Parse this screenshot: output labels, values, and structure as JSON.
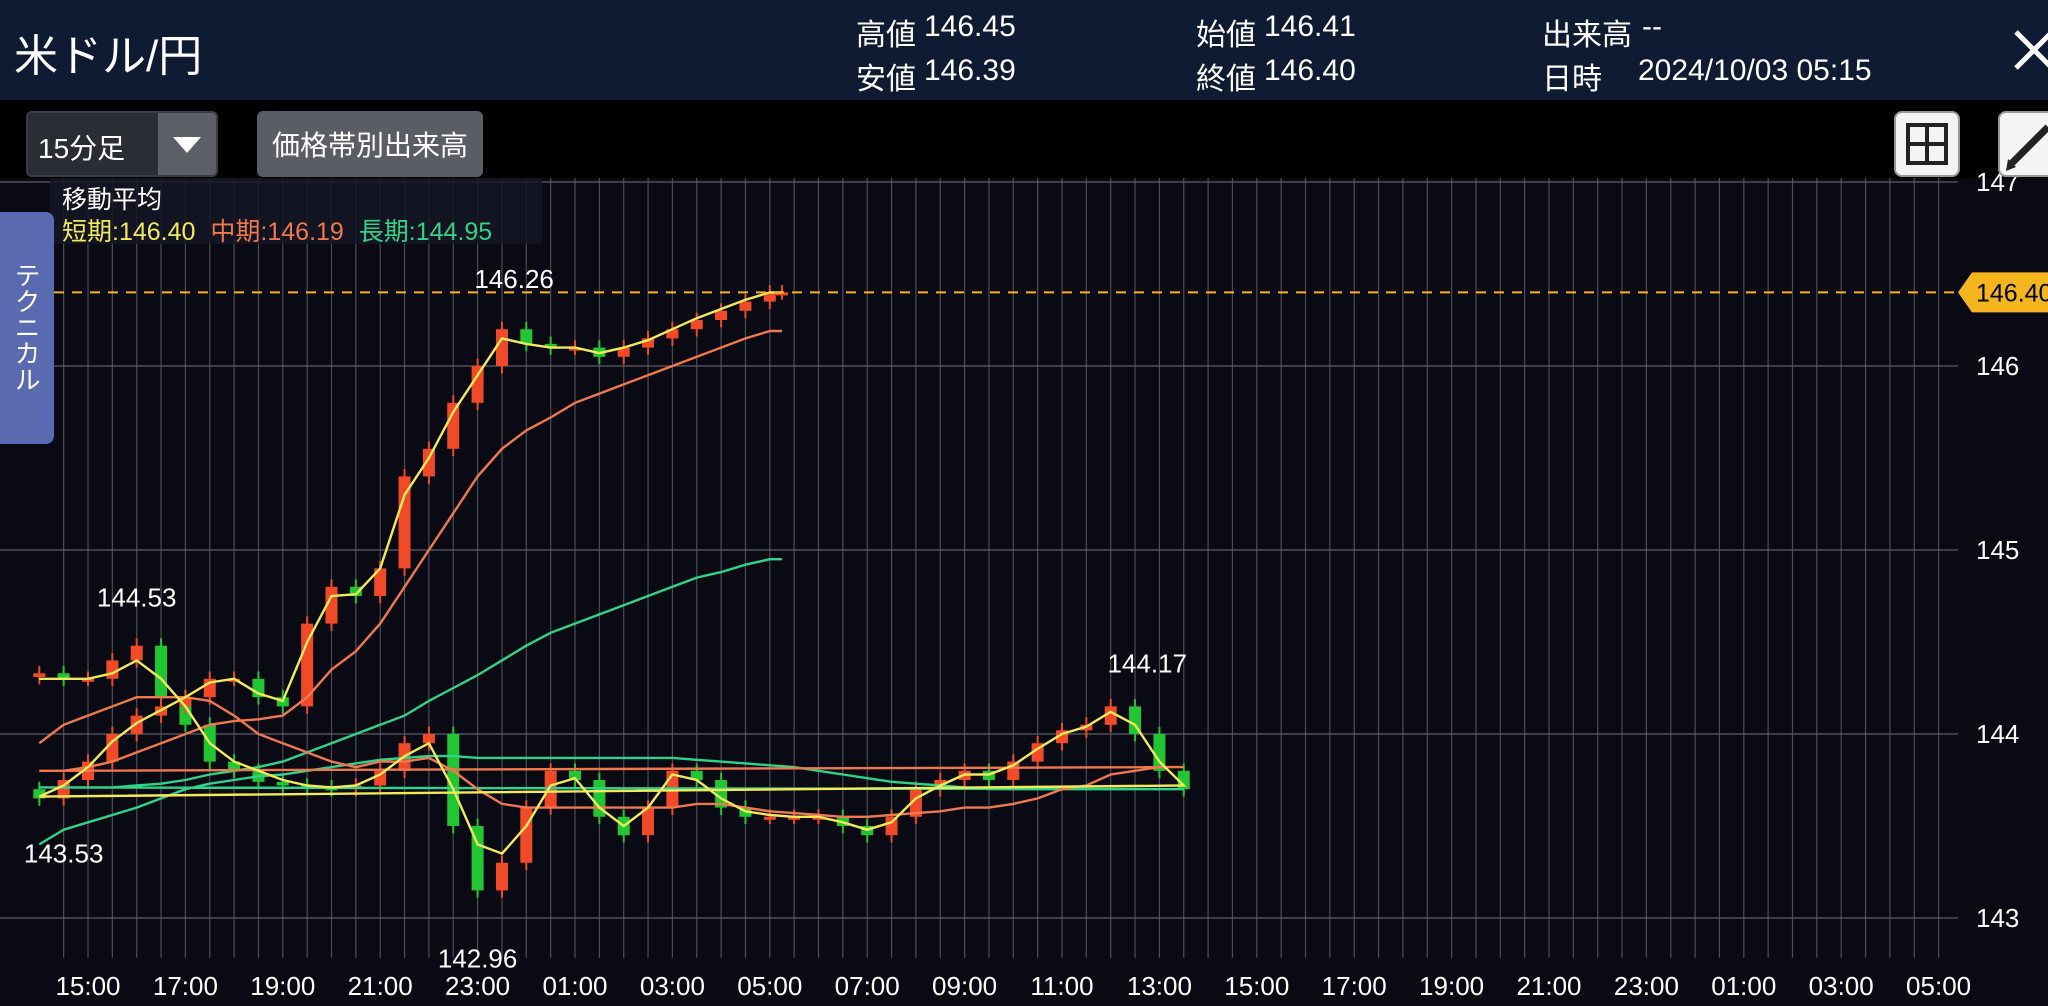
{
  "header": {
    "title": "米ドル/円",
    "stats": [
      {
        "label": "高値",
        "value": "146.45"
      },
      {
        "label": "安値",
        "value": "146.39"
      },
      {
        "label": "始値",
        "value": "146.41"
      },
      {
        "label": "終値",
        "value": "146.40"
      },
      {
        "label": "出来高",
        "value": "--"
      },
      {
        "label": "日時",
        "value": "2024/10/03 05:15"
      }
    ],
    "close_icon": "close-icon"
  },
  "toolbar": {
    "timeframe": "15分足",
    "volume_profile_label": "価格帯別出来高",
    "layout_icon": "grid-layout-icon",
    "draw_icon": "pencil-icon"
  },
  "side_tab": {
    "label": "テクニカル"
  },
  "ma_legend": {
    "title": "移動平均",
    "items": [
      {
        "label": "短期",
        "value": "146.40",
        "color": "#f2ea5a"
      },
      {
        "label": "中期",
        "value": "146.19",
        "color": "#f0784e"
      },
      {
        "label": "長期",
        "value": "144.95",
        "color": "#2fd48a"
      }
    ]
  },
  "chart_data": {
    "type": "candlestick",
    "title": "米ドル/円",
    "timeframe": "15分足",
    "x_ticks": [
      "15:00",
      "17:00",
      "19:00",
      "21:00",
      "23:00",
      "01:00",
      "03:00",
      "05:00",
      "07:00",
      "09:00",
      "11:00",
      "13:00",
      "15:00",
      "17:00",
      "19:00",
      "21:00",
      "23:00",
      "01:00",
      "03:00",
      "05:00"
    ],
    "y_ticks": [
      "143",
      "144",
      "145",
      "146",
      "147"
    ],
    "ylim": [
      142.8,
      147.0
    ],
    "current_price": "146.40",
    "annotations": [
      {
        "label": "144.53",
        "x": "16:00",
        "value": 144.53,
        "type": "high"
      },
      {
        "label": "142.96",
        "x": "23:00",
        "value": 142.96,
        "type": "low"
      },
      {
        "label": "144.17",
        "x": "12:45",
        "value": 144.17,
        "type": "high"
      },
      {
        "label": "143.53",
        "x": "14:30",
        "value": 143.53,
        "type": "low"
      },
      {
        "label": "146.26",
        "x": "23:45",
        "value": 146.26,
        "type": "high"
      }
    ],
    "up_color": "#f04a28",
    "down_color": "#22c532",
    "series_time": [
      "14:00",
      "14:30",
      "15:00",
      "15:30",
      "16:00",
      "16:30",
      "17:00",
      "17:30",
      "18:00",
      "18:30",
      "19:00",
      "19:30",
      "20:00",
      "20:30",
      "21:00",
      "21:30",
      "22:00",
      "22:30",
      "23:00",
      "23:30",
      "00:00",
      "00:30",
      "01:00",
      "01:30",
      "02:00",
      "02:30",
      "03:00",
      "03:30",
      "04:00",
      "04:30",
      "05:00",
      "05:30",
      "06:00",
      "06:30",
      "07:00",
      "07:30",
      "08:00",
      "08:30",
      "09:00",
      "09:30",
      "10:00",
      "10:30",
      "11:00",
      "11:30",
      "12:00",
      "12:30",
      "13:00",
      "13:30",
      "14:00",
      "14:30",
      "15:00",
      "15:30",
      "16:00",
      "16:30",
      "17:00",
      "17:30",
      "18:00",
      "18:30",
      "19:00",
      "19:30",
      "20:00",
      "20:30",
      "21:00",
      "21:30",
      "22:00",
      "22:30",
      "23:00",
      "23:30",
      "00:00",
      "00:30",
      "01:00",
      "01:30",
      "02:00",
      "02:30",
      "03:00",
      "03:30",
      "04:00",
      "04:30",
      "05:00",
      "05:15"
    ],
    "series_close": [
      144.33,
      144.3,
      144.3,
      144.4,
      144.48,
      144.2,
      144.05,
      143.85,
      143.8,
      143.74,
      143.72,
      143.71,
      143.7,
      143.72,
      143.8,
      143.95,
      144.0,
      143.5,
      143.15,
      143.3,
      143.6,
      143.8,
      143.75,
      143.55,
      143.45,
      143.6,
      143.8,
      143.75,
      143.6,
      143.55,
      143.55,
      143.55,
      143.55,
      143.5,
      143.45,
      143.55,
      143.7,
      143.75,
      143.8,
      143.75,
      143.85,
      143.95,
      144.02,
      144.05,
      144.15,
      144.0,
      143.8,
      143.7,
      143.65,
      143.75,
      143.85,
      144.0,
      144.1,
      144.15,
      144.2,
      144.3,
      144.3,
      144.2,
      144.15,
      144.6,
      144.8,
      144.75,
      144.9,
      145.4,
      145.55,
      145.8,
      146.0,
      146.2,
      146.12,
      146.1,
      146.1,
      146.05,
      146.1,
      146.15,
      146.2,
      146.25,
      146.3,
      146.35,
      146.4,
      146.4
    ],
    "ma_short": [
      144.3,
      144.3,
      144.3,
      144.33,
      144.4,
      144.3,
      144.15,
      143.95,
      143.85,
      143.8,
      143.75,
      143.72,
      143.71,
      143.72,
      143.78,
      143.88,
      143.95,
      143.7,
      143.4,
      143.35,
      143.5,
      143.72,
      143.76,
      143.6,
      143.5,
      143.6,
      143.78,
      143.75,
      143.65,
      143.58,
      143.56,
      143.55,
      143.55,
      143.52,
      143.48,
      143.52,
      143.65,
      143.72,
      143.78,
      143.78,
      143.83,
      143.92,
      144.0,
      144.04,
      144.12,
      144.05,
      143.85,
      143.72,
      143.66,
      143.72,
      143.82,
      143.96,
      144.06,
      144.13,
      144.2,
      144.28,
      144.3,
      144.22,
      144.18,
      144.5,
      144.75,
      144.76,
      144.9,
      145.3,
      145.5,
      145.75,
      145.95,
      146.15,
      146.12,
      146.1,
      146.1,
      146.07,
      146.1,
      146.14,
      146.2,
      146.26,
      146.31,
      146.36,
      146.4,
      146.4
    ],
    "ma_mid": [
      143.95,
      144.05,
      144.1,
      144.15,
      144.2,
      144.2,
      144.2,
      144.18,
      144.1,
      144.0,
      143.95,
      143.9,
      143.85,
      143.82,
      143.85,
      143.85,
      143.87,
      143.8,
      143.7,
      143.62,
      143.6,
      143.6,
      143.6,
      143.6,
      143.6,
      143.6,
      143.6,
      143.62,
      143.62,
      143.6,
      143.58,
      143.57,
      143.56,
      143.55,
      143.55,
      143.56,
      143.57,
      143.58,
      143.6,
      143.6,
      143.62,
      143.65,
      143.7,
      143.72,
      143.78,
      143.8,
      143.82,
      143.82,
      143.8,
      143.8,
      143.82,
      143.85,
      143.9,
      143.95,
      144.0,
      144.05,
      144.07,
      144.08,
      144.1,
      144.2,
      144.35,
      144.45,
      144.6,
      144.8,
      145.0,
      145.2,
      145.4,
      145.55,
      145.65,
      145.72,
      145.8,
      145.85,
      145.9,
      145.95,
      146.0,
      146.05,
      146.1,
      146.15,
      146.19,
      146.19
    ],
    "ma_long": [
      143.4,
      143.48,
      143.52,
      143.56,
      143.6,
      143.65,
      143.7,
      143.73,
      143.75,
      143.77,
      143.78,
      143.8,
      143.82,
      143.84,
      143.86,
      143.87,
      143.88,
      143.88,
      143.87,
      143.87,
      143.87,
      143.87,
      143.87,
      143.87,
      143.87,
      143.87,
      143.87,
      143.86,
      143.85,
      143.84,
      143.83,
      143.82,
      143.8,
      143.78,
      143.76,
      143.74,
      143.73,
      143.72,
      143.71,
      143.7,
      143.7,
      143.7,
      143.7,
      143.7,
      143.7,
      143.7,
      143.7,
      143.7,
      143.71,
      143.71,
      143.71,
      143.71,
      143.72,
      143.73,
      143.75,
      143.78,
      143.8,
      143.82,
      143.85,
      143.9,
      143.95,
      144.0,
      144.05,
      144.1,
      144.18,
      144.25,
      144.32,
      144.4,
      144.48,
      144.55,
      144.6,
      144.65,
      144.7,
      144.75,
      144.8,
      144.85,
      144.88,
      144.92,
      144.95,
      144.95
    ]
  }
}
